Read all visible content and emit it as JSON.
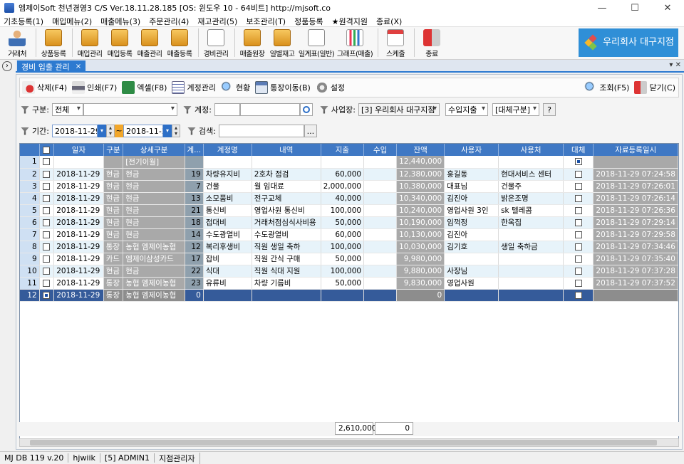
{
  "window": {
    "title": "엠제이Soft 천년경영3 C/S  Ver.18.11.28.185  [OS: 윈도우 10 - 64비트]   http://mjsoft.co",
    "controls": [
      "—",
      "☐",
      "✕"
    ]
  },
  "menu": [
    "기초등록(1)",
    "매입메뉴(2)",
    "매출메뉴(3)",
    "주문관리(4)",
    "재고관리(5)",
    "보조관리(T)",
    "정품등록",
    "★원격지원",
    "종료(X)"
  ],
  "toolbar": [
    {
      "label": "거래처",
      "icon": "person-icon"
    },
    {
      "label": "상품등록",
      "icon": "box-icon"
    },
    {
      "label": "매입관리",
      "icon": "purchase-icon"
    },
    {
      "label": "매입등록",
      "icon": "purchase-add-icon"
    },
    {
      "label": "매출관리",
      "icon": "sales-icon"
    },
    {
      "label": "매출등록",
      "icon": "sales-add-icon"
    },
    {
      "label": "경비관리",
      "icon": "expense-icon"
    },
    {
      "label": "매출원장",
      "icon": "ledger-icon"
    },
    {
      "label": "일별재고",
      "icon": "daily-stock-icon"
    },
    {
      "label": "일계표(일반)",
      "icon": "daily-report-icon"
    },
    {
      "label": "그래프(매출)",
      "icon": "chart-icon"
    },
    {
      "label": "스케줄",
      "icon": "calendar-icon"
    },
    {
      "label": "종료",
      "icon": "exit-icon"
    }
  ],
  "logo": {
    "text": "우리회사 대구지점"
  },
  "tab": {
    "label": "경비 입출 관리",
    "close": "×",
    "controls": "▾ ✕"
  },
  "subtoolbar": {
    "left": [
      {
        "label": "삭제(F4)",
        "icon": "delete-icon"
      },
      {
        "label": "인쇄(F7)",
        "icon": "print-icon"
      },
      {
        "label": "엑셀(F8)",
        "icon": "excel-icon"
      },
      {
        "label": "계정관리",
        "icon": "account-icon"
      },
      {
        "label": "현황",
        "icon": "status-search-icon"
      },
      {
        "label": "통장이동(B)",
        "icon": "bankbook-icon"
      },
      {
        "label": "설정",
        "icon": "settings-icon"
      }
    ],
    "right": [
      {
        "label": "조회(F5)",
        "icon": "search-icon"
      },
      {
        "label": "닫기(C)",
        "icon": "close-icon"
      }
    ]
  },
  "filters": {
    "type_label": "구분:",
    "type_value": "전체",
    "type_sub_value": "",
    "account_label": "계정:",
    "account_code": "",
    "account_value": "",
    "branch_label": "사업장:",
    "branch_value": "[3] 우리회사 대구지점",
    "expense_kind": "수입지출",
    "replace_kind": "[대체구분]",
    "help": "?",
    "period_label": "기간:",
    "date_from": "2018-11-29",
    "tilde": "~",
    "date_to": "2018-11-29",
    "search_label": "검색:",
    "search_value": "",
    "search_btn": "..."
  },
  "grid": {
    "columns": [
      "",
      "일자",
      "구분",
      "상세구분",
      "계...",
      "계정명",
      "내역",
      "지출",
      "수입",
      "잔액",
      "사용자",
      "사용처",
      "대체",
      "자료등록일시"
    ],
    "rows": [
      {
        "n": "1",
        "date": "",
        "kind": "",
        "detail": "[전기이월]",
        "code": "",
        "account": "",
        "desc": "",
        "out": "",
        "in": "",
        "bal": "12,440,000",
        "user": "",
        "place": "",
        "replace": true,
        "reg": ""
      },
      {
        "n": "2",
        "date": "2018-11-29",
        "kind": "현금",
        "detail": "현금",
        "code": "19",
        "account": "차량유지비",
        "desc": "2호차 점검",
        "out": "60,000",
        "in": "",
        "bal": "12,380,000",
        "user": "홍길동",
        "place": "현대서비스 센터",
        "replace": false,
        "reg": "2018-11-29 07:24:58"
      },
      {
        "n": "3",
        "date": "2018-11-29",
        "kind": "현금",
        "detail": "현금",
        "code": "7",
        "account": "건물",
        "desc": "월 임대료",
        "out": "2,000,000",
        "in": "",
        "bal": "10,380,000",
        "user": "대표님",
        "place": "건물주",
        "replace": false,
        "reg": "2018-11-29 07:26:01"
      },
      {
        "n": "4",
        "date": "2018-11-29",
        "kind": "현금",
        "detail": "현금",
        "code": "13",
        "account": "소모품비",
        "desc": "전구교체",
        "out": "40,000",
        "in": "",
        "bal": "10,340,000",
        "user": "김진아",
        "place": "밝은조명",
        "replace": false,
        "reg": "2018-11-29 07:26:14"
      },
      {
        "n": "5",
        "date": "2018-11-29",
        "kind": "현금",
        "detail": "현금",
        "code": "21",
        "account": "통신비",
        "desc": "영업사원 통신비",
        "out": "100,000",
        "in": "",
        "bal": "10,240,000",
        "user": "영업사원 3인",
        "place": "sk 텔레콤",
        "replace": false,
        "reg": "2018-11-29 07:26:36"
      },
      {
        "n": "6",
        "date": "2018-11-29",
        "kind": "현금",
        "detail": "현금",
        "code": "18",
        "account": "접대비",
        "desc": "거래처점심식사비용",
        "out": "50,000",
        "in": "",
        "bal": "10,190,000",
        "user": "임꺽정",
        "place": "한옥집",
        "replace": false,
        "reg": "2018-11-29 07:29:14"
      },
      {
        "n": "7",
        "date": "2018-11-29",
        "kind": "현금",
        "detail": "현금",
        "code": "14",
        "account": "수도광열비",
        "desc": "수도광열비",
        "out": "60,000",
        "in": "",
        "bal": "10,130,000",
        "user": "김진아",
        "place": "",
        "replace": false,
        "reg": "2018-11-29 07:29:58"
      },
      {
        "n": "8",
        "date": "2018-11-29",
        "kind": "통장",
        "detail": "농협 엠제이농협",
        "code": "12",
        "account": "복리후생비",
        "desc": "직원 생일 축하",
        "out": "100,000",
        "in": "",
        "bal": "10,030,000",
        "user": "김기호",
        "place": "생일 축하금",
        "replace": false,
        "reg": "2018-11-29 07:34:46"
      },
      {
        "n": "9",
        "date": "2018-11-29",
        "kind": "카드",
        "detail": "엠제이삼성카드",
        "code": "17",
        "account": "잡비",
        "desc": "직원 간식 구매",
        "out": "50,000",
        "in": "",
        "bal": "9,980,000",
        "user": "",
        "place": "",
        "replace": false,
        "reg": "2018-11-29 07:35:40"
      },
      {
        "n": "10",
        "date": "2018-11-29",
        "kind": "현금",
        "detail": "현금",
        "code": "22",
        "account": "식대",
        "desc": "직원 식대 지원",
        "out": "100,000",
        "in": "",
        "bal": "9,880,000",
        "user": "사장님",
        "place": "",
        "replace": false,
        "reg": "2018-11-29 07:37:28"
      },
      {
        "n": "11",
        "date": "2018-11-29",
        "kind": "통장",
        "detail": "농협 엠제이농협",
        "code": "23",
        "account": "유류비",
        "desc": "차량 기름비",
        "out": "50,000",
        "in": "",
        "bal": "9,830,000",
        "user": "영업사원",
        "place": "",
        "replace": false,
        "reg": "2018-11-29 07:37:52"
      },
      {
        "n": "12",
        "date": "2018-11-29",
        "kind": "통장",
        "detail": "농협 엠제이농협",
        "code": "0",
        "account": "",
        "desc": "",
        "out": "",
        "in": "",
        "bal": "0",
        "user": "",
        "place": "",
        "replace": false,
        "reg": "",
        "selected": true,
        "checked": true
      }
    ]
  },
  "totals": {
    "out": "2,610,000",
    "in": "0"
  },
  "status": [
    "MJ DB 119 v.20",
    "hjwiik",
    "[5] ADMIN1",
    "지점관리자"
  ],
  "colors": {
    "accent": "#2d7ad0",
    "header": "#3f78c4",
    "selected_row": "#355b9a"
  }
}
